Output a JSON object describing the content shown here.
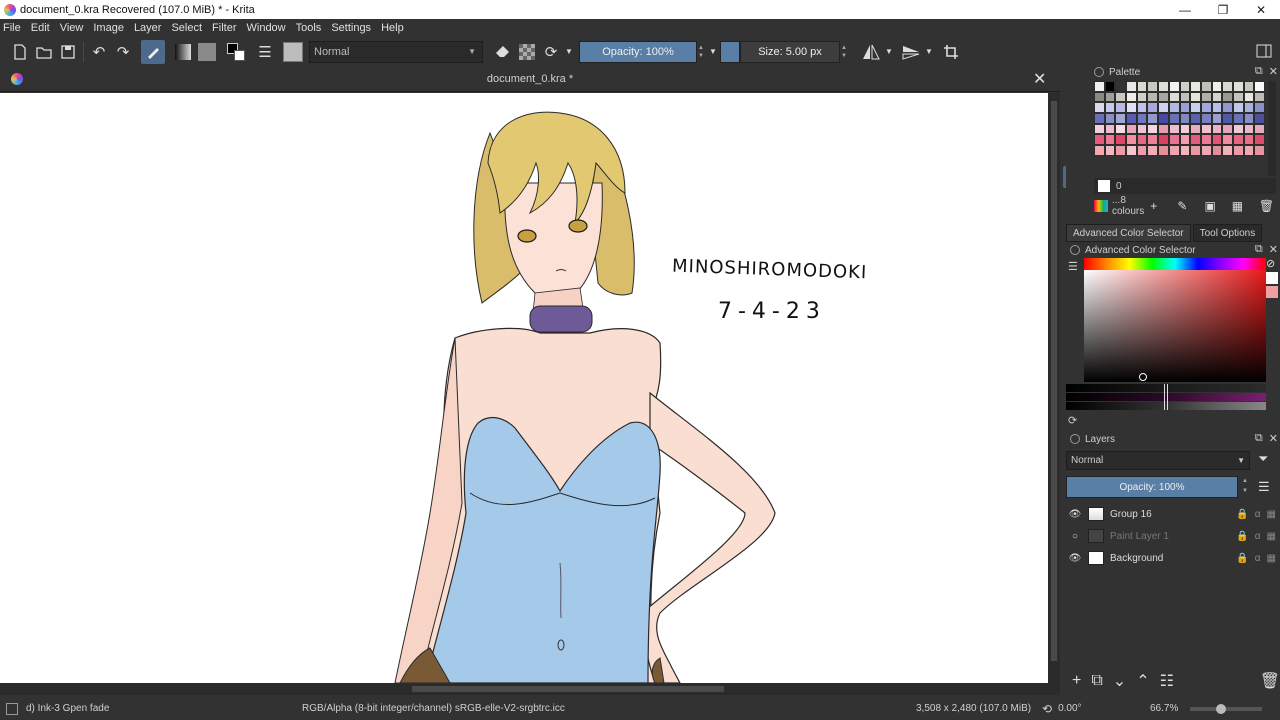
{
  "window": {
    "title": "document_0.kra Recovered  (107.0 MiB)  * - Krita",
    "controls": [
      "—",
      "❐",
      "✕"
    ]
  },
  "menu": [
    "File",
    "Edit",
    "View",
    "Image",
    "Layer",
    "Select",
    "Filter",
    "Window",
    "Tools",
    "Settings",
    "Help"
  ],
  "toolbar": {
    "blend_mode": "Normal",
    "opacity_label": "Opacity: 100%",
    "opacity_value": 1.0,
    "size_label": "Size: 5.00 px"
  },
  "document": {
    "tab_title": "document_0.kra *",
    "canvas_text_name": "MINOSHIROMODOKI",
    "canvas_text_date": "7-4-23"
  },
  "palette": {
    "title": "Palette",
    "current_index": "0",
    "palette_name": "...8 colours",
    "colors": [
      "#f0f0f0",
      "#000000",
      "#333333",
      "#e8e8e8",
      "#d8d8d0",
      "#c8c8c0",
      "#e0e0d8",
      "#f4f4f0",
      "#d0d0c8",
      "#e8e8e0",
      "#c0c0b8",
      "#f0f0e8",
      "#d8d8d0",
      "#e0e0d8",
      "#c8c8c0",
      "#f8f8f8",
      "#8a8a82",
      "#a0a098",
      "#c8c8c0",
      "#eeeee6",
      "#d0d0c6",
      "#b8b8b0",
      "#a8a8a0",
      "#dcdcd4",
      "#c0c0b8",
      "#e4e4dc",
      "#b0b0a8",
      "#d4d4cc",
      "#9a9a92",
      "#c4c4bc",
      "#e8e8e0",
      "#bcbcb4",
      "#d8d8ee",
      "#c8c8e8",
      "#b8b8e0",
      "#e0e0f4",
      "#c0c0e8",
      "#a8a8dc",
      "#d0d0f0",
      "#b0b8e4",
      "#98a0d8",
      "#c8d0ee",
      "#a0a8dc",
      "#b8c0e8",
      "#9098d0",
      "#c0c8ec",
      "#a8b0e0",
      "#8890c8",
      "#6870b8",
      "#8890c8",
      "#a0a8d8",
      "#5a5ab0",
      "#7078c0",
      "#9098d0",
      "#4848a8",
      "#6870b8",
      "#8088c8",
      "#5a62b0",
      "#7880c0",
      "#9aa0d4",
      "#5058a8",
      "#6a72b8",
      "#888ec8",
      "#4a52a0",
      "#f4d0dc",
      "#eebacc",
      "#f8dce4",
      "#e8a8bc",
      "#f0c4d2",
      "#f6d6e0",
      "#e49cb2",
      "#eebcca",
      "#f4ccd8",
      "#e8aebe",
      "#f0c0ce",
      "#eab4c4",
      "#e4a4b8",
      "#f2c8d4",
      "#ecb8c8",
      "#e6aabe",
      "#e85a7a",
      "#f07890",
      "#e04868",
      "#f490a4",
      "#e86884",
      "#f0809a",
      "#dc4060",
      "#ec7090",
      "#f49cb0",
      "#e45c7c",
      "#ee7a94",
      "#e25474",
      "#f08ca2",
      "#e66680",
      "#ea7088",
      "#de4c6c",
      "#f4a8b0",
      "#f0b8c0",
      "#ec9aa4",
      "#f6c4ca",
      "#ee9ea8",
      "#f2aeb6",
      "#e8909a",
      "#f0a4ae",
      "#f4b4bc",
      "#ea98a2",
      "#eea6b0",
      "#e48c98",
      "#f2b0b8",
      "#ec9ca6",
      "#f0a8b2",
      "#e694a0"
    ]
  },
  "docker_tabs": [
    "Advanced Color Selector",
    "Tool Options"
  ],
  "color_selector": {
    "title": "Advanced Color Selector"
  },
  "layers": {
    "title": "Layers",
    "blend_mode": "Normal",
    "opacity_label": "Opacity:  100%",
    "items": [
      {
        "name": "Group 16",
        "visible": true,
        "dim": false
      },
      {
        "name": "Paint Layer 1",
        "visible": false,
        "dim": true
      },
      {
        "name": "Background",
        "visible": true,
        "dim": false
      }
    ]
  },
  "status": {
    "brush": "d) Ink-3 Gpen fade",
    "color_space": "RGB/Alpha (8-bit integer/channel)  sRGB-elle-V2-srgbtrc.icc",
    "image_size": "3,508 x 2,480 (107.0 MiB)",
    "rotation": "0.00°",
    "zoom": "66.7%"
  },
  "colors": {
    "accent": "#5a7fa6",
    "panel_bg": "#323232",
    "canvas_bg": "#ffffff"
  }
}
